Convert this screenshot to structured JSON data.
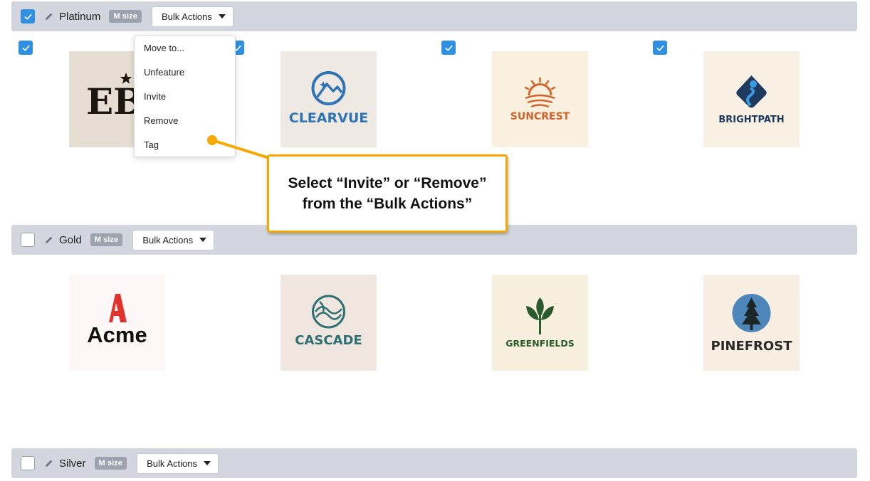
{
  "tiers": [
    {
      "name": "Platinum",
      "size": "M size",
      "bulk": "Bulk Actions",
      "checked": true
    },
    {
      "name": "Gold",
      "size": "M size",
      "bulk": "Bulk Actions",
      "checked": false
    },
    {
      "name": "Silver",
      "size": "M size",
      "bulk": "Bulk Actions",
      "checked": false
    }
  ],
  "logos": {
    "ebix": "EBIX",
    "clearvue": "CLEARVUE",
    "suncrest": "SUNCREST",
    "brightpath": "BRIGHTPATH",
    "acme": "Acme",
    "cascade": "CASCADE",
    "greenfields": "GREENFIELDS",
    "pinefrost": "PINEFROST"
  },
  "menu": {
    "items": [
      "Move to...",
      "Unfeature",
      "Invite",
      "Remove",
      "Tag"
    ]
  },
  "callout": {
    "text": "Select “Invite” or “Remove” from the “Bulk Actions”"
  },
  "colors": {
    "checkbox": "#2e8fe3",
    "tier_bar": "#d3d6de",
    "badge": "#9ca2ae",
    "callout_border": "#f5a900"
  }
}
